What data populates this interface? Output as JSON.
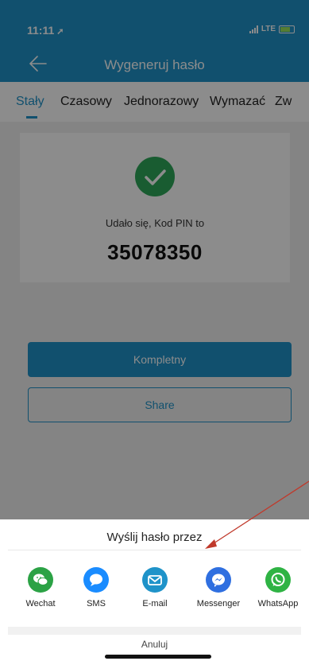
{
  "status_bar": {
    "time": "11:11",
    "location_arrow": "➚",
    "network": "LTE"
  },
  "nav": {
    "title": "Wygeneruj hasło"
  },
  "tabs": [
    {
      "label": "Stały",
      "active": true
    },
    {
      "label": "Czasowy",
      "active": false
    },
    {
      "label": "Jednorazowy",
      "active": false
    },
    {
      "label": "Wymazać",
      "active": false
    },
    {
      "label": "Zw",
      "active": false
    }
  ],
  "result": {
    "message": "Udało się, Kod PIN to",
    "pin": "35078350"
  },
  "buttons": {
    "complete": "Kompletny",
    "share": "Share"
  },
  "share_sheet": {
    "title": "Wyślij hasło przez",
    "options": [
      {
        "label": "Wechat",
        "icon": "wechat-icon",
        "color": "#2ba245"
      },
      {
        "label": "SMS",
        "icon": "sms-icon",
        "color": "#1a8cff"
      },
      {
        "label": "E-mail",
        "icon": "email-icon",
        "color": "#1f93c9"
      },
      {
        "label": "Messenger",
        "icon": "messenger-icon",
        "color": "#2f6fe0"
      },
      {
        "label": "WhatsApp",
        "icon": "whatsapp-icon",
        "color": "#2fb344"
      }
    ],
    "cancel": "Anuluj"
  },
  "colors": {
    "primary": "#1f93c9",
    "success": "#2ea85a",
    "annotation_arrow": "#c0392b"
  }
}
